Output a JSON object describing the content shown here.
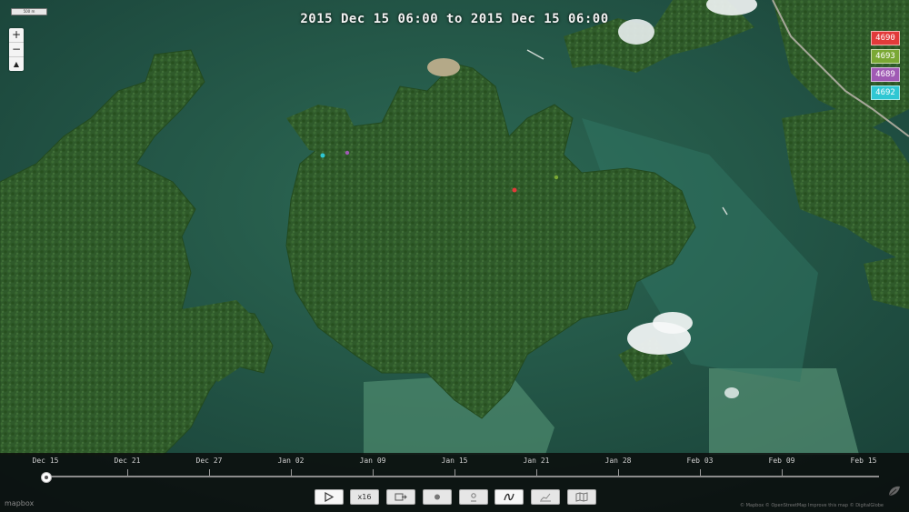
{
  "title": "2015 Dec 15 06:00 to 2015 Dec 15 06:00",
  "scale_label": "500 m",
  "zoom": {
    "in": "+",
    "out": "−",
    "compass": "▲"
  },
  "legend": [
    {
      "id": "4690",
      "color": "#e23a3a"
    },
    {
      "id": "4693",
      "color": "#7aa834"
    },
    {
      "id": "4689",
      "color": "#a05ab4"
    },
    {
      "id": "4692",
      "color": "#2fc7d3"
    }
  ],
  "timeline": {
    "ticks": [
      "Dec 15",
      "Dec 21",
      "Dec 27",
      "Jan 02",
      "Jan 09",
      "Jan 15",
      "Jan 21",
      "Jan 28",
      "Feb 03",
      "Feb 09",
      "Feb 15"
    ],
    "progress": 0
  },
  "controls": {
    "speed_label": "x16"
  },
  "footer": {
    "logo": "mapbox",
    "attribution": "© Mapbox © OpenStreetMap Improve this map © DigitalGlobe"
  }
}
